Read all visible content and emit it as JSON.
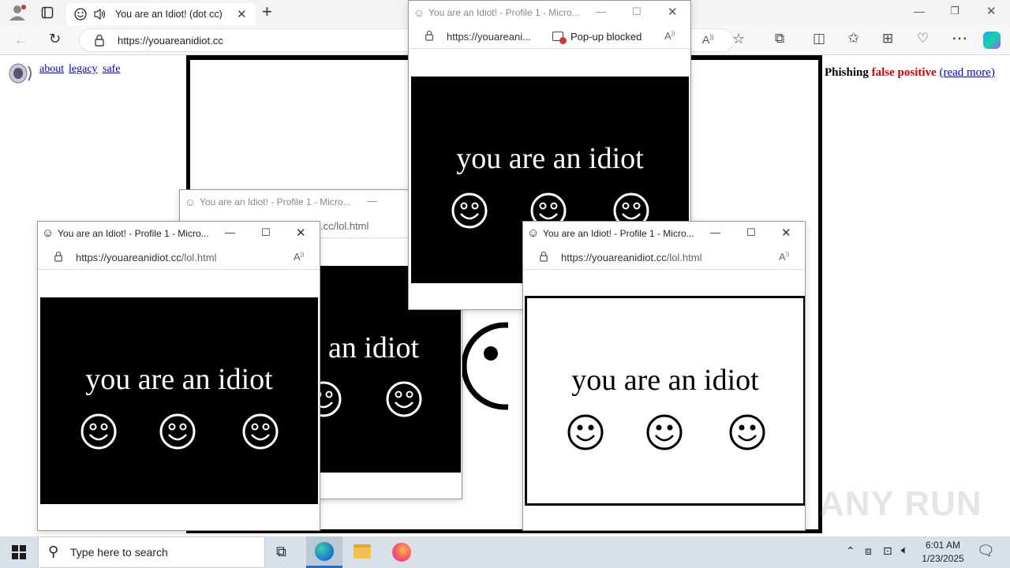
{
  "browser": {
    "tab": {
      "title": "You are an Idiot! (dot cc)",
      "icon": "smiley-icon",
      "audio_icon": "speaker-icon"
    },
    "url": "https://youareanidiot.cc",
    "toolbar_icons": [
      "back-icon",
      "refresh-icon",
      "lock-icon",
      "read-aloud-icon",
      "favorite-star-icon",
      "extensions-icon",
      "split-screen-icon",
      "favorites-icon",
      "collections-icon",
      "browser-essentials-icon",
      "more-icon",
      "copilot-icon"
    ]
  },
  "page": {
    "nav_links": [
      "about",
      "legacy",
      "safe"
    ],
    "phishing_notice": {
      "word": "Phishing",
      "highlight": "false positive",
      "link": "(read more)"
    },
    "colors": {
      "highlight_red": "#cc0000",
      "link_blue": "#0000cc"
    }
  },
  "popups": [
    {
      "id": "popup-back",
      "title": "You are an Idiot! - Profile 1 - Micro...",
      "url": "https://youareanidiot.cc/lol.html",
      "url_visible": ".cc/lol.html",
      "message": "you are an idiot",
      "visible_message": "an idiot"
    },
    {
      "id": "popup-top",
      "title": "You are an Idiot! - Profile 1 - Micro...",
      "url_visible": "https://youareani...",
      "popup_status": "Pop-up blocked",
      "message": "you are an idiot"
    },
    {
      "id": "popup-left",
      "title": "You are an Idiot! - Profile 1 - Micro...",
      "url_host": "https://youareanidiot.cc",
      "url_path": "/lol.html",
      "message": "you are an idiot"
    },
    {
      "id": "popup-right",
      "title": "You are an Idiot! - Profile 1 - Micro...",
      "url_host": "https://youareanidiot.cc",
      "url_path": "/lol.html",
      "message": "you are an idiot"
    }
  ],
  "watermark": "ANY RUN",
  "taskbar": {
    "search_placeholder": "Type here to search",
    "time": "6:01 AM",
    "date": "1/23/2025",
    "pinned": [
      "task-view-icon",
      "edge-icon",
      "file-explorer-icon",
      "firefox-icon"
    ]
  }
}
